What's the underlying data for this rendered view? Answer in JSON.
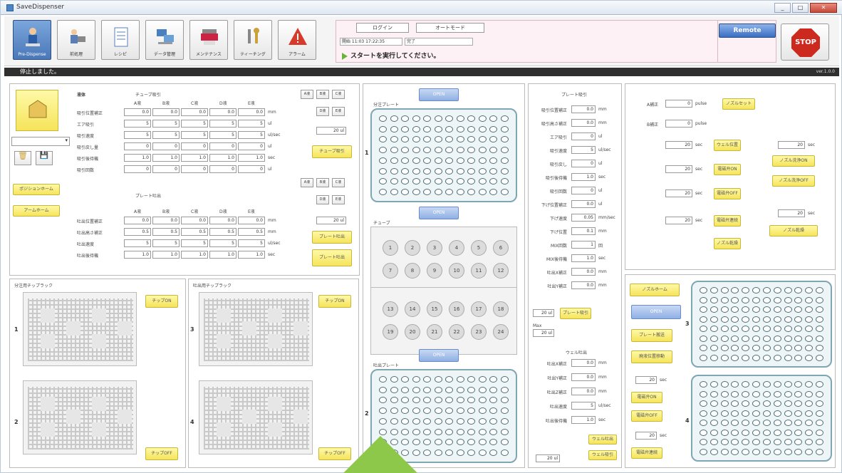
{
  "window": {
    "title": "SaveDispenser",
    "btn_min": "_",
    "btn_max": "□",
    "btn_close": "✕"
  },
  "toolbar": {
    "tools": [
      {
        "label": "Pre-Dispense",
        "icon": "person-icon",
        "active": true
      },
      {
        "label": "前処理",
        "icon": "scientist-icon",
        "active": false
      },
      {
        "label": "レシピ",
        "icon": "checklist-icon",
        "active": false
      },
      {
        "label": "データ管理",
        "icon": "computers-icon",
        "active": false
      },
      {
        "label": "メンテナンス",
        "icon": "printer-icon",
        "active": false
      },
      {
        "label": "ティーチング",
        "icon": "tools-icon",
        "active": false
      },
      {
        "label": "アラーム",
        "icon": "warning-icon",
        "active": false
      }
    ]
  },
  "header": {
    "login": "ログイン",
    "mode": "オートモード",
    "datetime": "開始 11:03 17:22:35",
    "status": "完了",
    "message": "スタートを実行してください。",
    "remote": "Remote",
    "stop": "STOP"
  },
  "statusbar": {
    "text": "停止しました。",
    "version": "ver.1.0.0"
  },
  "liquid": {
    "title": "液体",
    "tube_title": "チューブ吸引",
    "plate_title": "プレート吐出",
    "cols": [
      "A液",
      "B液",
      "C液",
      "D液",
      "E液"
    ],
    "tube_rows": [
      {
        "label": "吸引位置補正",
        "vals": [
          "0.0",
          "0.0",
          "0.0",
          "0.0",
          "0.0"
        ],
        "unit": "mm"
      },
      {
        "label": "エア吸引",
        "vals": [
          "5",
          "5",
          "5",
          "5",
          "5"
        ],
        "unit": "ul"
      },
      {
        "label": "吸引速度",
        "vals": [
          "5",
          "5",
          "5",
          "5",
          "5"
        ],
        "unit": "ul/sec"
      },
      {
        "label": "吸引戻し量",
        "vals": [
          "0",
          "0",
          "0",
          "0",
          "0"
        ],
        "unit": "ul"
      },
      {
        "label": "吸引後待機",
        "vals": [
          "1.0",
          "1.0",
          "1.0",
          "1.0",
          "1.0"
        ],
        "unit": "sec"
      },
      {
        "label": "吸引回数",
        "vals": [
          "0",
          "0",
          "0",
          "0",
          "0"
        ],
        "unit": "ul"
      }
    ],
    "plate_rows": [
      {
        "label": "吐出位置補正",
        "vals": [
          "0.0",
          "0.0",
          "0.0",
          "0.0",
          "0.0"
        ],
        "unit": "mm"
      },
      {
        "label": "吐出高さ補正",
        "vals": [
          "0.5",
          "0.5",
          "0.5",
          "0.5",
          "0.5"
        ],
        "unit": "mm"
      },
      {
        "label": "吐出速度",
        "vals": [
          "5",
          "5",
          "5",
          "5",
          "5"
        ],
        "unit": "ul/sec"
      },
      {
        "label": "吐出後待機",
        "vals": [
          "1.0",
          "1.0",
          "1.0",
          "1.0",
          "1.0"
        ],
        "unit": "sec"
      }
    ],
    "side_btn_labels": [
      "A液",
      "B液",
      "C液",
      "D液",
      "E液"
    ],
    "vol1": "20 ul",
    "vol2": "20 ul",
    "tube_btn": "チューブ吸引",
    "plate_btn": "プレート吐出",
    "plate_btn2": "プレート吐出"
  },
  "left_side": {
    "btn1": "ポジションホーム",
    "btn2": "アームホーム"
  },
  "racks": {
    "left_title": "分注用チップラック",
    "right_title": "吐出用チップラック",
    "btn_chip_on": "チップON",
    "btn_chip_off": "チップOFF",
    "labels": [
      "1",
      "2",
      "3",
      "4"
    ]
  },
  "center": {
    "top_plate": "分注プレート",
    "tube": "チューブ",
    "bottom_plate": "吐出プレート",
    "btn": "OPEN",
    "tubes": [
      "1",
      "2",
      "3",
      "4",
      "5",
      "6",
      "7",
      "8",
      "9",
      "10",
      "11",
      "12",
      "13",
      "14",
      "15",
      "16",
      "17",
      "18",
      "19",
      "20",
      "21",
      "22",
      "23",
      "24"
    ],
    "num1": "1",
    "num2": "2"
  },
  "plate_settings": {
    "title": "プレート吸引",
    "rows": [
      {
        "label": "吸引位置補正",
        "val": "0.0",
        "unit": "mm"
      },
      {
        "label": "吸引高さ補正",
        "val": "0.0",
        "unit": "mm"
      },
      {
        "label": "エア吸引",
        "val": "0",
        "unit": "ul"
      },
      {
        "label": "吸引速度",
        "val": "5",
        "unit": "ul/sec"
      },
      {
        "label": "吸引戻し",
        "val": "0",
        "unit": "ul"
      },
      {
        "label": "吸引後待機",
        "val": "1.0",
        "unit": "sec"
      },
      {
        "label": "吸引回数",
        "val": "0",
        "unit": "ul"
      },
      {
        "label": "下げ位置補正",
        "val": "0.0",
        "unit": "ul"
      },
      {
        "label": "下げ速度",
        "val": "0.05",
        "unit": "mm/sec"
      },
      {
        "label": "下げ位置",
        "val": "0.1",
        "unit": "mm"
      },
      {
        "label": "MIX回数",
        "val": "1",
        "unit": "回"
      },
      {
        "label": "MIX後待機",
        "val": "1.0",
        "unit": "sec"
      },
      {
        "label": "吐出X補正",
        "val": "0.0",
        "unit": "mm"
      },
      {
        "label": "吐出Y補正",
        "val": "0.0",
        "unit": "mm"
      }
    ],
    "vol": "20 ul",
    "vol_btn": "プレート吸引",
    "max_label": "Max",
    "max_vol": "20 ul",
    "sub_title": "ウェル吐出",
    "sub_rows": [
      {
        "label": "吐出X補正",
        "val": "0.0",
        "unit": "mm"
      },
      {
        "label": "吐出Y補正",
        "val": "0.0",
        "unit": "mm"
      },
      {
        "label": "吐出Z補正",
        "val": "0.0",
        "unit": "mm"
      },
      {
        "label": "吐出速度",
        "val": "5",
        "unit": "ul/sec"
      },
      {
        "label": "吐出後待機",
        "val": "1.0",
        "unit": "sec"
      }
    ],
    "sub_btn1": "ウェル吐出",
    "sub_btn2": "ウェル吸引",
    "sub_vol": "20 ul"
  },
  "right_top": {
    "row1_label": "A補正",
    "row1_val": "0",
    "row1_unit": "pulse",
    "row2_label": "B補正",
    "row2_val": "0",
    "row2_unit": "pulse",
    "btn_nozzle_set": "ノズルセット",
    "times": [
      "20",
      "20",
      "20",
      "20"
    ],
    "time_unit": "sec",
    "btns": [
      "ウェル位置",
      "電磁弁ON",
      "電磁弁OFF",
      "電磁弁連続"
    ],
    "time_r": "20",
    "time_r2": "20",
    "btns_r": [
      "ノズル洗浄ON",
      "ノズル洗浄OFF",
      "ノズル乾燥"
    ],
    "btn_nozzle_dry": "ノズル乾燥"
  },
  "right_bottom": {
    "btn1": "ノズルホーム",
    "btn2": "OPEN",
    "btn3": "プレート搬送",
    "btn4": "廃液位置移動",
    "time": "20",
    "unit": "sec",
    "btn5": "電磁弁ON",
    "btn6": "電磁弁OFF",
    "time2": "20",
    "btn7": "電磁弁連続",
    "num3": "3",
    "num4": "4"
  }
}
